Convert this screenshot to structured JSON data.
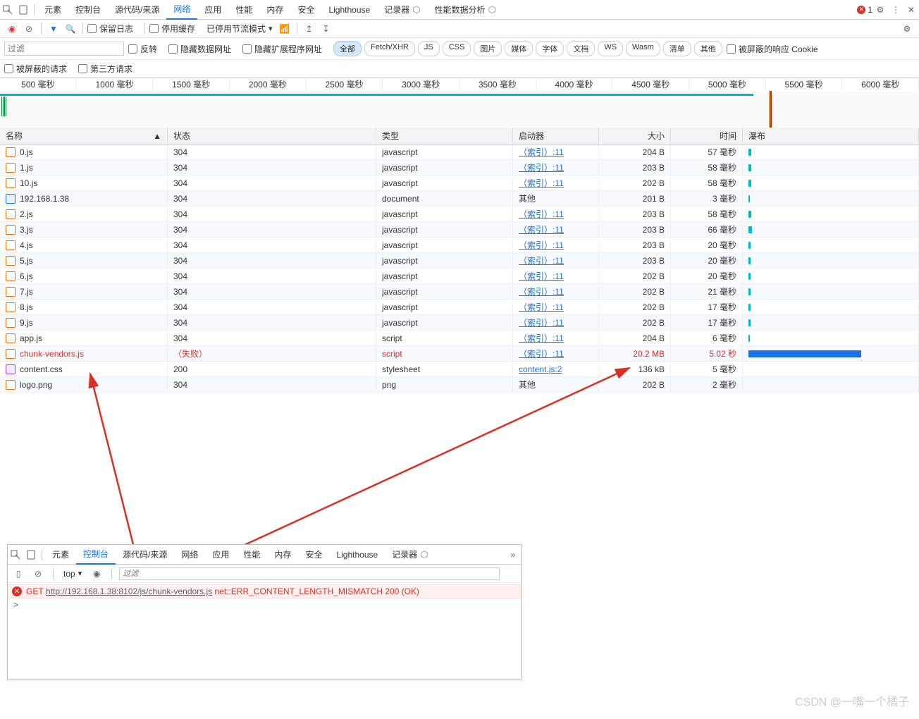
{
  "topTabs": [
    "元素",
    "控制台",
    "源代码/来源",
    "网络",
    "应用",
    "性能",
    "内存",
    "安全",
    "Lighthouse",
    "记录器",
    "性能数据分析"
  ],
  "topActive": 3,
  "errorBadge": "1",
  "toolbar": {
    "preserve": "保留日志",
    "disableCache": "停用缓存",
    "throttle": "已停用节流模式"
  },
  "filterPlaceholder": "过滤",
  "filterRow": {
    "invert": "反转",
    "hideDataUrls": "隐藏数据网址",
    "hideExtUrls": "隐藏扩展程序网址",
    "pills": [
      "全部",
      "Fetch/XHR",
      "JS",
      "CSS",
      "图片",
      "媒体",
      "字体",
      "文档",
      "WS",
      "Wasm",
      "清单",
      "其他"
    ],
    "pillActive": 0,
    "blockedCookie": "被屏蔽的响应 Cookie",
    "blockedReq": "被屏蔽的请求",
    "thirdParty": "第三方请求"
  },
  "timelineTicks": [
    "500 毫秒",
    "1000 毫秒",
    "1500 毫秒",
    "2000 毫秒",
    "2500 毫秒",
    "3000 毫秒",
    "3500 毫秒",
    "4000 毫秒",
    "4500 毫秒",
    "5000 毫秒",
    "5500 毫秒",
    "6000 毫秒"
  ],
  "columns": {
    "name": "名称",
    "status": "状态",
    "type": "类型",
    "initiator": "启动器",
    "size": "大小",
    "time": "时间",
    "waterfall": "瀑布"
  },
  "rows": [
    {
      "name": "0.js",
      "status": "304",
      "type": "javascript",
      "init": "（索引）:11",
      "initLink": true,
      "size": "204 B",
      "time": "57 毫秒",
      "ico": "js",
      "wf": 4
    },
    {
      "name": "1.js",
      "status": "304",
      "type": "javascript",
      "init": "（索引）:11",
      "initLink": true,
      "size": "203 B",
      "time": "58 毫秒",
      "ico": "js",
      "wf": 4
    },
    {
      "name": "10.js",
      "status": "304",
      "type": "javascript",
      "init": "（索引）:11",
      "initLink": true,
      "size": "202 B",
      "time": "58 毫秒",
      "ico": "js",
      "wf": 4
    },
    {
      "name": "192.168.1.38",
      "status": "304",
      "type": "document",
      "init": "其他",
      "initLink": false,
      "size": "201 B",
      "time": "3 毫秒",
      "ico": "doc",
      "wf": 2
    },
    {
      "name": "2.js",
      "status": "304",
      "type": "javascript",
      "init": "（索引）:11",
      "initLink": true,
      "size": "203 B",
      "time": "58 毫秒",
      "ico": "js",
      "wf": 4
    },
    {
      "name": "3.js",
      "status": "304",
      "type": "javascript",
      "init": "（索引）:11",
      "initLink": true,
      "size": "203 B",
      "time": "66 毫秒",
      "ico": "js",
      "wf": 5
    },
    {
      "name": "4.js",
      "status": "304",
      "type": "javascript",
      "init": "（索引）:11",
      "initLink": true,
      "size": "203 B",
      "time": "20 毫秒",
      "ico": "js",
      "wf": 3
    },
    {
      "name": "5.js",
      "status": "304",
      "type": "javascript",
      "init": "（索引）:11",
      "initLink": true,
      "size": "203 B",
      "time": "20 毫秒",
      "ico": "js",
      "wf": 3
    },
    {
      "name": "6.js",
      "status": "304",
      "type": "javascript",
      "init": "（索引）:11",
      "initLink": true,
      "size": "202 B",
      "time": "20 毫秒",
      "ico": "js",
      "wf": 3
    },
    {
      "name": "7.js",
      "status": "304",
      "type": "javascript",
      "init": "（索引）:11",
      "initLink": true,
      "size": "202 B",
      "time": "21 毫秒",
      "ico": "js",
      "wf": 3
    },
    {
      "name": "8.js",
      "status": "304",
      "type": "javascript",
      "init": "（索引）:11",
      "initLink": true,
      "size": "202 B",
      "time": "17 毫秒",
      "ico": "js",
      "wf": 3
    },
    {
      "name": "9.js",
      "status": "304",
      "type": "javascript",
      "init": "（索引）:11",
      "initLink": true,
      "size": "202 B",
      "time": "17 毫秒",
      "ico": "js",
      "wf": 3
    },
    {
      "name": "app.js",
      "status": "304",
      "type": "script",
      "init": "（索引）:11",
      "initLink": true,
      "size": "204 B",
      "time": "6 毫秒",
      "ico": "jsb",
      "wf": 2
    },
    {
      "name": "chunk-vendors.js",
      "status": "（失败）",
      "type": "script",
      "init": "（索引）:11",
      "initLink": true,
      "size": "20.2 MB",
      "time": "5.02 秒",
      "ico": "jsb",
      "wf": 160,
      "big": true,
      "red": true
    },
    {
      "name": "content.css",
      "status": "200",
      "type": "stylesheet",
      "init": "content.js:2",
      "initLink": true,
      "size": "136 kB",
      "time": "5 毫秒",
      "ico": "css",
      "wf": 0
    },
    {
      "name": "logo.png",
      "status": "304",
      "type": "png",
      "init": "其他",
      "initLink": false,
      "size": "202 B",
      "time": "2 毫秒",
      "ico": "js",
      "wf": 0
    }
  ],
  "console": {
    "tabs": [
      "元素",
      "控制台",
      "源代码/来源",
      "网络",
      "应用",
      "性能",
      "内存",
      "安全",
      "Lighthouse",
      "记录器"
    ],
    "activeTab": 1,
    "scope": "top",
    "filterPlaceholder": "过滤",
    "err": {
      "method": "GET",
      "url": "http://192.168.1.38:8102/js/chunk-vendors.js",
      "msg": "net::ERR_CONTENT_LENGTH_MISMATCH 200 (OK)"
    },
    "prompt": ">"
  },
  "watermark": "CSDN @一嘴一个橘子"
}
